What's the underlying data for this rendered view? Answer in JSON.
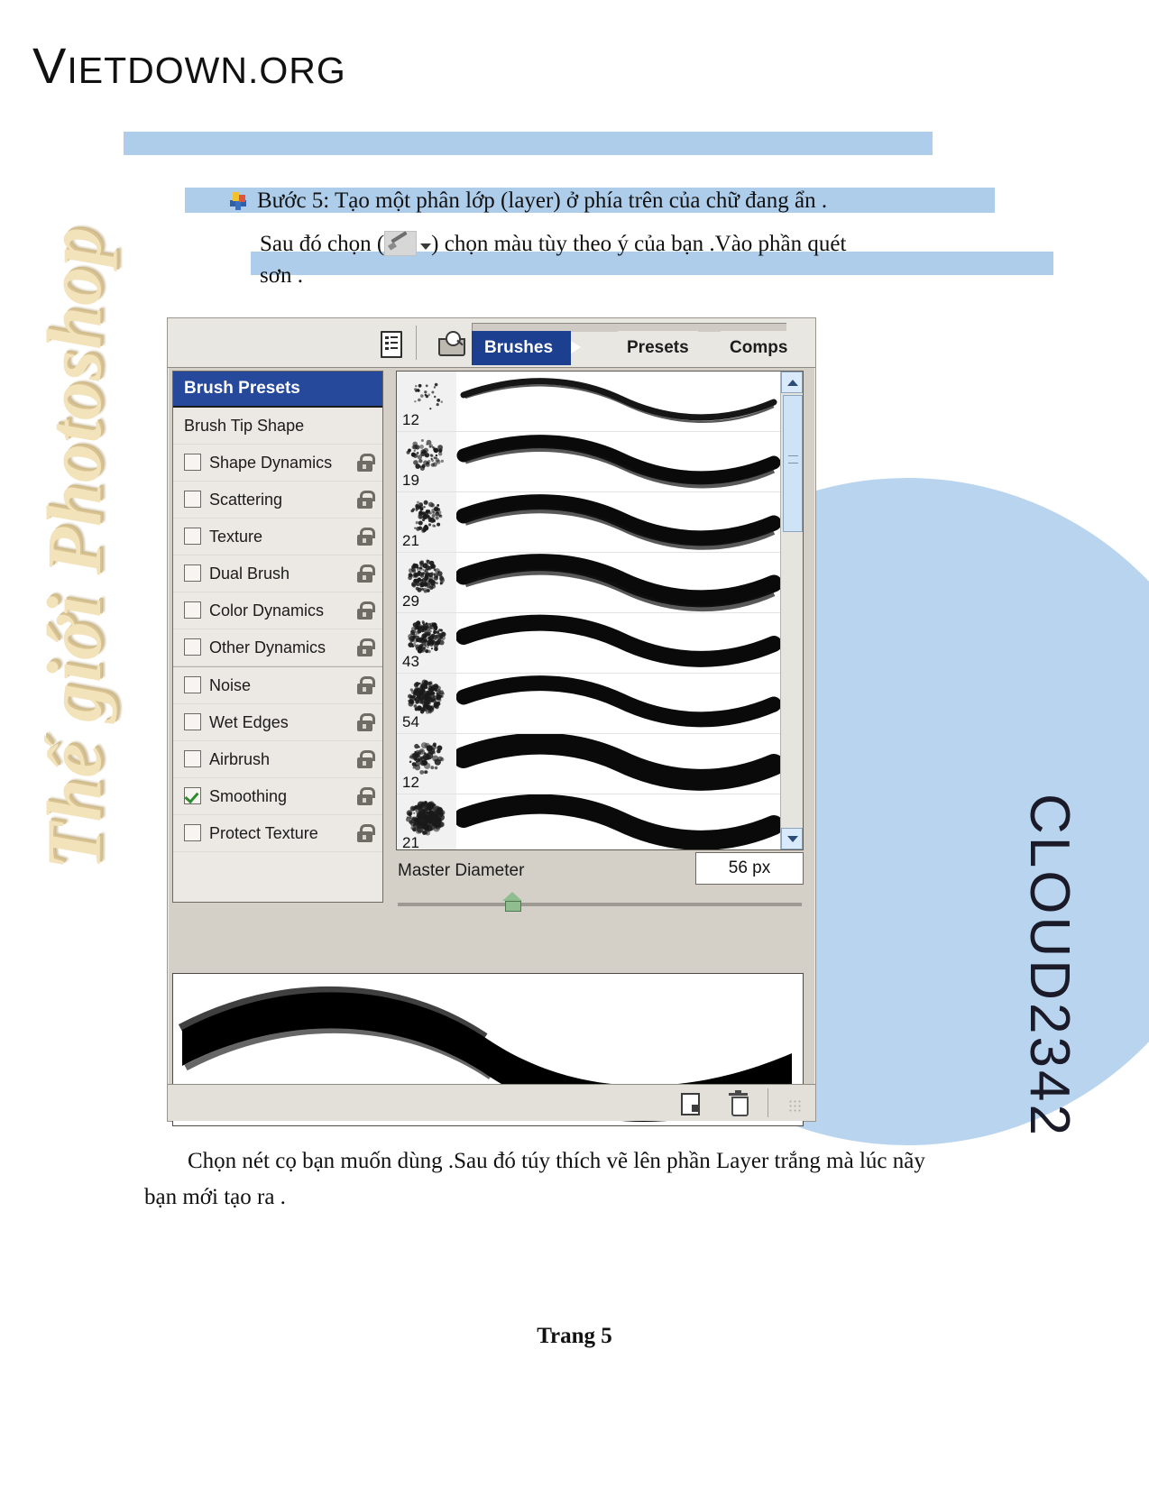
{
  "header": {
    "logo_main": "V",
    "logo_rest": "IETDOWN.ORG"
  },
  "watermark": {
    "left_text": "Thế giới Photoshop",
    "right_text": "CLOUD2342"
  },
  "content": {
    "step_line_1": "Bước 5: Tạo một phân lớp (layer) ở phía trên của chữ đang ẩn .",
    "line_2_before": "Sau đó chọn (",
    "line_2_after": ") chọn màu tùy theo ý của bạn .Vào phần quét",
    "line_3": "sơn .",
    "bottom_paragraph": "Chọn nét cọ bạn muốn dùng .Sau đó túy thích vẽ lên phần Layer trắng mà lúc nãy bạn mới tạo ra .",
    "page_number": "Trang 5"
  },
  "photoshop_panel": {
    "toolbar": {
      "list_icon": "document-list-icon",
      "browser_icon": "file-browser-icon"
    },
    "tabs": [
      {
        "label": "Brushes",
        "active": true
      },
      {
        "label": "Presets",
        "active": false
      },
      {
        "label": "Comps",
        "active": false
      }
    ],
    "sidebar": {
      "header": "Brush Presets",
      "items": [
        {
          "label": "Brush Tip Shape",
          "checkbox": false,
          "checked": false,
          "lock": false
        },
        {
          "label": "Shape Dynamics",
          "checkbox": true,
          "checked": false,
          "lock": true
        },
        {
          "label": "Scattering",
          "checkbox": true,
          "checked": false,
          "lock": true
        },
        {
          "label": "Texture",
          "checkbox": true,
          "checked": false,
          "lock": true
        },
        {
          "label": "Dual Brush",
          "checkbox": true,
          "checked": false,
          "lock": true
        },
        {
          "label": "Color Dynamics",
          "checkbox": true,
          "checked": false,
          "lock": true
        },
        {
          "label": "Other Dynamics",
          "checkbox": true,
          "checked": false,
          "lock": true
        },
        {
          "label": "Noise",
          "checkbox": true,
          "checked": false,
          "lock": true,
          "group_start": true
        },
        {
          "label": "Wet Edges",
          "checkbox": true,
          "checked": false,
          "lock": true
        },
        {
          "label": "Airbrush",
          "checkbox": true,
          "checked": false,
          "lock": true
        },
        {
          "label": "Smoothing",
          "checkbox": true,
          "checked": true,
          "lock": true
        },
        {
          "label": "Protect Texture",
          "checkbox": true,
          "checked": false,
          "lock": true
        }
      ]
    },
    "brush_list": {
      "sizes": [
        "12",
        "19",
        "21",
        "29",
        "43",
        "54",
        "12",
        "21"
      ],
      "scrollbar": {
        "up_arrow": "chevron-up-icon",
        "down_arrow": "chevron-down-icon"
      }
    },
    "master_diameter": {
      "label": "Master Diameter",
      "value": "56 px"
    },
    "footer": {
      "new_brush_icon": "new-brush-icon",
      "delete_brush_icon": "trash-icon"
    }
  },
  "colors": {
    "accent_blue": "#26499b",
    "tab_active": "#1c3f8f",
    "highlight_bar": "#aecdea",
    "circle": "#b9d4ef",
    "panel_bg": "#d4d0c8",
    "watermark_cream": "#f3e3bb"
  }
}
